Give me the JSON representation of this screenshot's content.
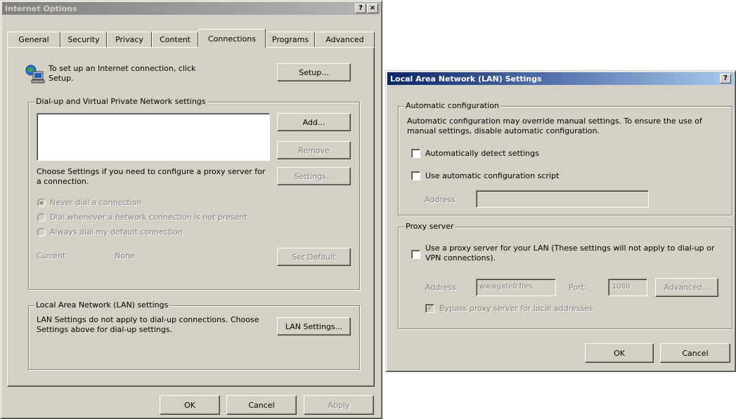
{
  "internet_options": {
    "title": "Internet Options",
    "title_help": "?",
    "title_close": "×",
    "tabs": [
      "General",
      "Security",
      "Privacy",
      "Content",
      "Connections",
      "Programs",
      "Advanced"
    ],
    "selected_tab": "Connections",
    "setup_text": "To set up an Internet connection, click Setup.",
    "setup_button": "Setup...",
    "dialup_group": "Dial-up and Virtual Private Network settings",
    "add_button": "Add...",
    "remove_button": "Remove",
    "settings_text": "Choose Settings if you need to configure a proxy server for a connection.",
    "settings_button": "Settings...",
    "radio_never": "Never dial a connection",
    "radio_whenever": "Dial whenever a network connection is not present",
    "radio_always": "Always dial my default connection",
    "current_label": "Current",
    "current_value": "None",
    "set_default_button": "Set Default",
    "lan_group": "Local Area Network (LAN) settings",
    "lan_text": "LAN Settings do not apply to dial-up connections. Choose Settings above for dial-up settings.",
    "lan_button": "LAN Settings...",
    "ok": "OK",
    "cancel": "Cancel",
    "apply": "Apply"
  },
  "lan_settings": {
    "title": "Local Area Network (LAN) Settings",
    "title_help": "?",
    "title_close": "×",
    "auto_group": "Automatic configuration",
    "auto_text": "Automatic configuration may override manual settings. To ensure the use of manual settings, disable automatic configuration.",
    "auto_detect": "Automatically detect settings",
    "auto_script": "Use automatic configuration script",
    "address_label": "Address",
    "address_value": "",
    "proxy_group": "Proxy server",
    "proxy_use": "Use a proxy server for your LAN (These settings will not apply to dial-up or VPN connections).",
    "proxy_address_label": "Address:",
    "proxy_address_value": "wwwgate0.fres",
    "port_label": "Port:",
    "port_value": "1080",
    "advanced_button": "Advanced...",
    "bypass_label": "Bypass proxy server for local addresses",
    "ok": "OK",
    "cancel": "Cancel"
  }
}
